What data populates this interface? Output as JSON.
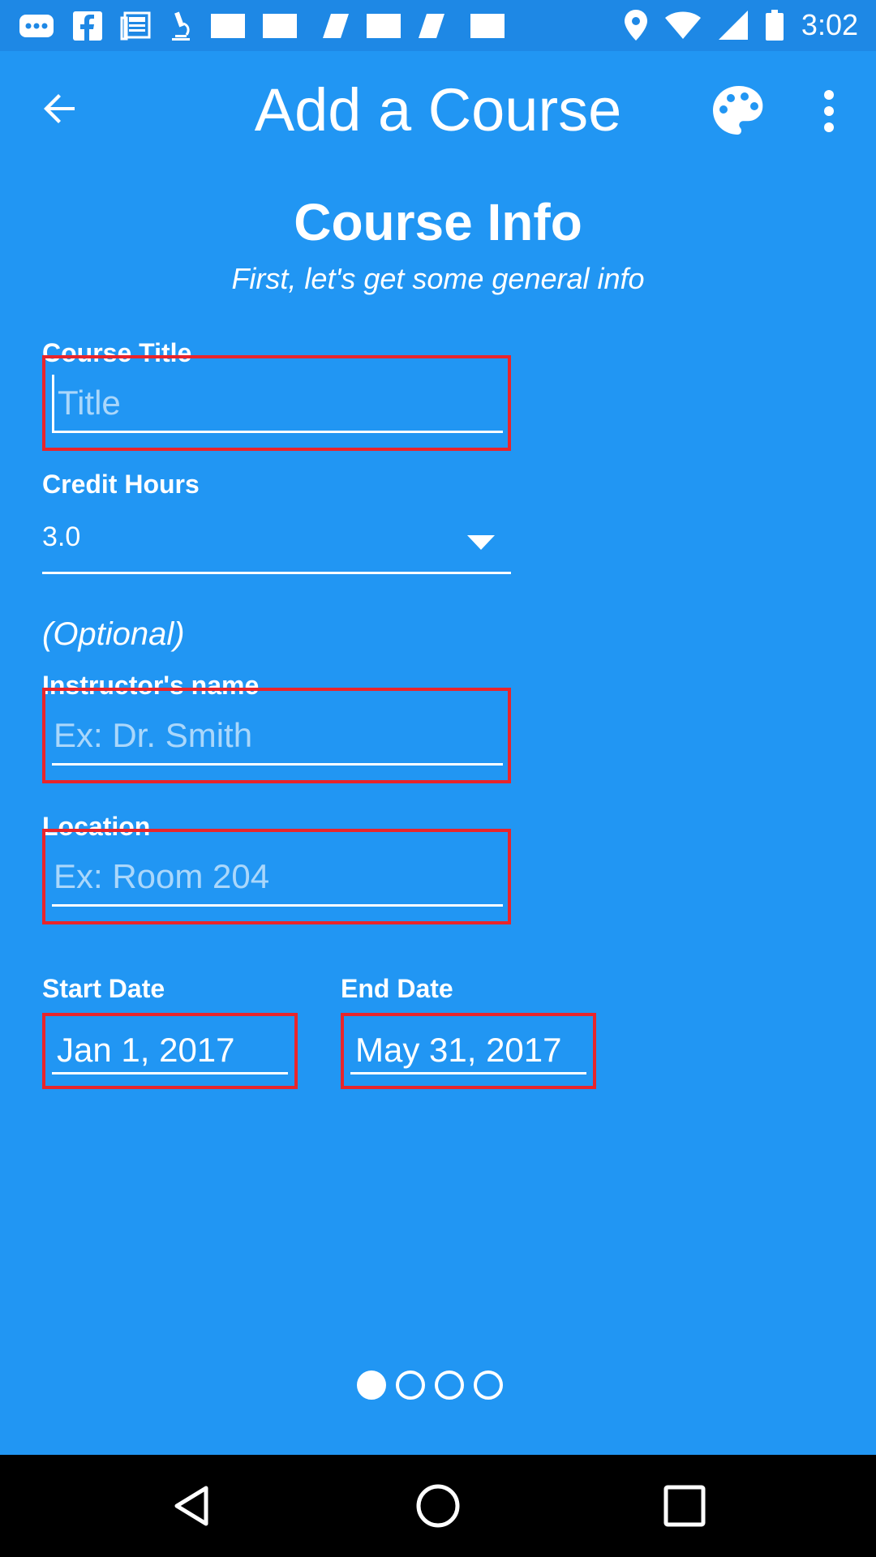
{
  "status_bar": {
    "time": "3:02",
    "left_icons": [
      "more-dots-icon",
      "facebook-icon",
      "news-icon",
      "microscope-icon",
      "image-icon",
      "image-icon",
      "feather-icon",
      "image-icon",
      "feather-icon",
      "image-icon"
    ],
    "right_icons": [
      "location-icon",
      "wifi-icon",
      "signal-icon",
      "battery-icon"
    ]
  },
  "app_bar": {
    "title": "Add a Course",
    "back_icon": "arrow-back-icon",
    "palette_icon": "palette-icon",
    "more_icon": "more-vert-icon"
  },
  "page": {
    "heading": "Course Info",
    "subheading": "First, let's get some general info"
  },
  "form": {
    "course_title": {
      "label": "Course Title",
      "placeholder": "Title",
      "value": ""
    },
    "credit_hours": {
      "label": "Credit Hours",
      "value": "3.0"
    },
    "optional_label": "(Optional)",
    "instructor": {
      "label": "Instructor's name",
      "placeholder": "Ex: Dr. Smith",
      "value": ""
    },
    "location": {
      "label": "Location",
      "placeholder": "Ex: Room 204",
      "value": ""
    },
    "start_date": {
      "label": "Start Date",
      "value": "Jan 1, 2017"
    },
    "end_date": {
      "label": "End Date",
      "value": "May 31, 2017"
    }
  },
  "pager": {
    "total": 4,
    "current": 1
  },
  "nav_bar": {
    "icons": [
      "back-triangle-icon",
      "home-circle-icon",
      "recents-square-icon"
    ]
  },
  "colors": {
    "background": "#2196f3",
    "status_bar": "#1e88e5",
    "highlight_border": "#e8252b",
    "text": "#ffffff",
    "nav_bar": "#000000"
  }
}
